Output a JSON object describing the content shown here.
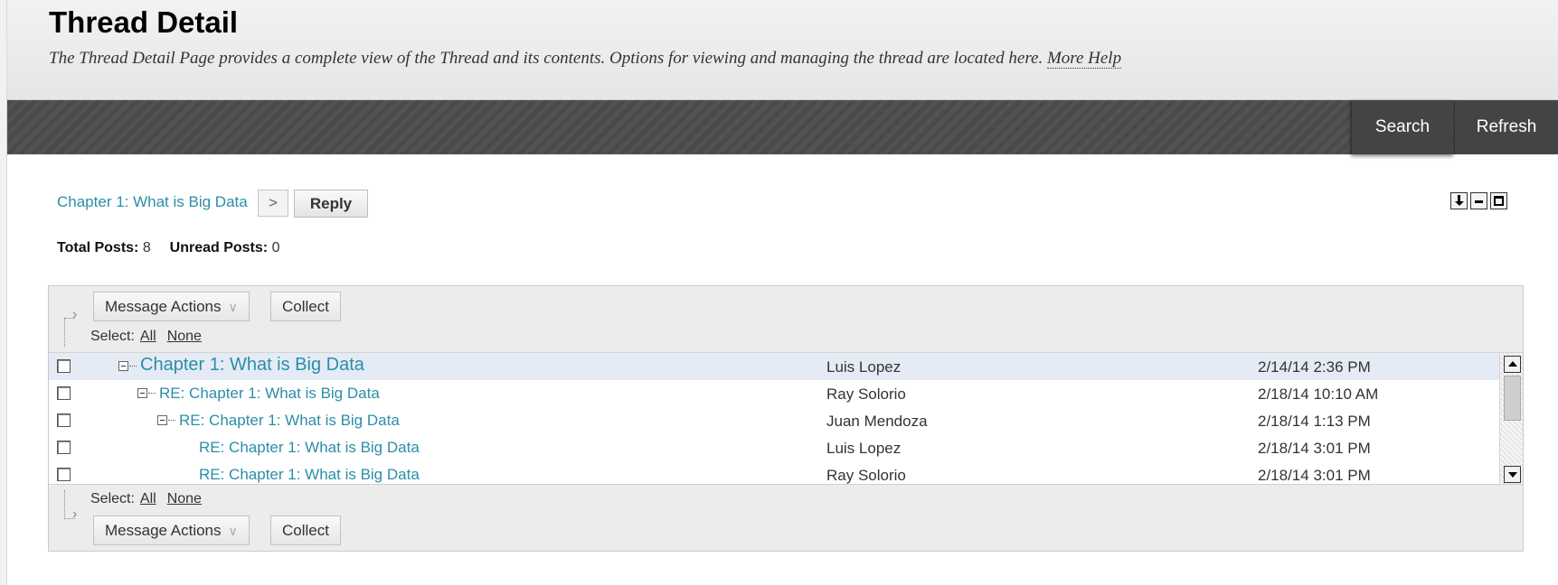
{
  "header": {
    "title": "Thread Detail",
    "description": "The Thread Detail Page provides a complete view of the Thread and its contents. Options for viewing and managing the thread are located here.",
    "more_help": "More Help"
  },
  "action_bar": {
    "search_label": "Search",
    "refresh_label": "Refresh"
  },
  "breadcrumb": {
    "thread_link": "Chapter 1: What is Big Data",
    "arrow": ">",
    "reply_label": "Reply"
  },
  "counts": {
    "total_label": "Total Posts:",
    "total_value": "8",
    "unread_label": "Unread Posts:",
    "unread_value": "0"
  },
  "toolbar": {
    "message_actions_label": "Message Actions",
    "collect_label": "Collect",
    "select_label": "Select:",
    "select_all": "All",
    "select_none": "None"
  },
  "posts": [
    {
      "subject": "Chapter 1: What is Big Data",
      "author": "Luis Lopez",
      "date": "2/14/14 2:36 PM"
    },
    {
      "subject": "RE: Chapter 1: What is Big Data",
      "author": "Ray Solorio",
      "date": "2/18/14 10:10 AM"
    },
    {
      "subject": "RE: Chapter 1: What is Big Data",
      "author": "Juan Mendoza",
      "date": "2/18/14 1:13 PM"
    },
    {
      "subject": "RE: Chapter 1: What is Big Data",
      "author": "Luis Lopez",
      "date": "2/18/14 3:01 PM"
    },
    {
      "subject": "RE: Chapter 1: What is Big Data",
      "author": "Ray Solorio",
      "date": "2/18/14 3:01 PM"
    }
  ],
  "icons": {
    "expand": "download-icon",
    "collapse": "minimize-icon",
    "maximize": "maximize-icon",
    "tree_toggle": "collapse-minus-icon"
  },
  "colors": {
    "link": "#2b8ea8",
    "action_bar": "#4a4a4a",
    "highlight_row": "#e4ebf5"
  }
}
